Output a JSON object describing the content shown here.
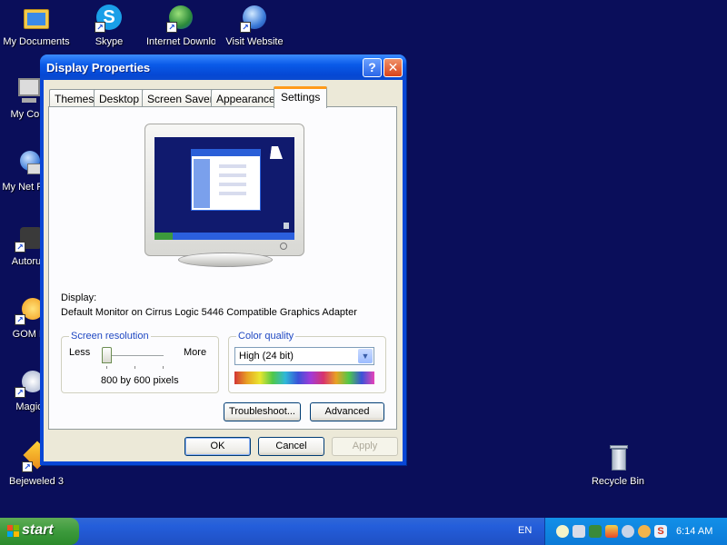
{
  "desktop": {
    "icons": [
      {
        "label": "My Documents",
        "icon": "folder-icon"
      },
      {
        "label": "Skype",
        "icon": "skype-icon"
      },
      {
        "label": "Internet Downlo",
        "icon": "globe-download-icon"
      },
      {
        "label": "Visit Website",
        "icon": "globe-icon"
      },
      {
        "label": "My Com",
        "icon": "computer-icon"
      },
      {
        "label": "My Net Plac",
        "icon": "network-icon"
      },
      {
        "label": "Autorun",
        "icon": "autorun-icon"
      },
      {
        "label": "GOM P",
        "icon": "gom-player-icon"
      },
      {
        "label": "Magic",
        "icon": "magic-icon"
      },
      {
        "label": "Bejeweled 3",
        "icon": "bejeweled-icon"
      },
      {
        "label": "Recycle Bin",
        "icon": "recycle-bin-icon"
      }
    ]
  },
  "dialog": {
    "title": "Display Properties",
    "help_button": "?",
    "close_button": "✕",
    "tabs": [
      {
        "label": "Themes"
      },
      {
        "label": "Desktop"
      },
      {
        "label": "Screen Saver"
      },
      {
        "label": "Appearance"
      },
      {
        "label": "Settings"
      }
    ],
    "active_tab": "Settings",
    "display_label": "Display:",
    "display_value": "Default Monitor on Cirrus Logic 5446 Compatible Graphics Adapter",
    "resolution": {
      "group_title": "Screen resolution",
      "less_label": "Less",
      "more_label": "More",
      "value_text": "800 by 600 pixels",
      "slider_level": 0
    },
    "color_quality": {
      "group_title": "Color quality",
      "selected": "High (24 bit)"
    },
    "buttons": {
      "troubleshoot": "Troubleshoot...",
      "advanced": "Advanced",
      "ok": "OK",
      "cancel": "Cancel",
      "apply": "Apply"
    }
  },
  "taskbar": {
    "start_label": "start",
    "language": "EN",
    "clock": "6:14 AM"
  },
  "colors": {
    "desktop_background": "#0a0e5a",
    "title_bar": "#0a5ae8",
    "start_button": "#3c9a3c",
    "tab_highlight": "#ff9a1a"
  }
}
